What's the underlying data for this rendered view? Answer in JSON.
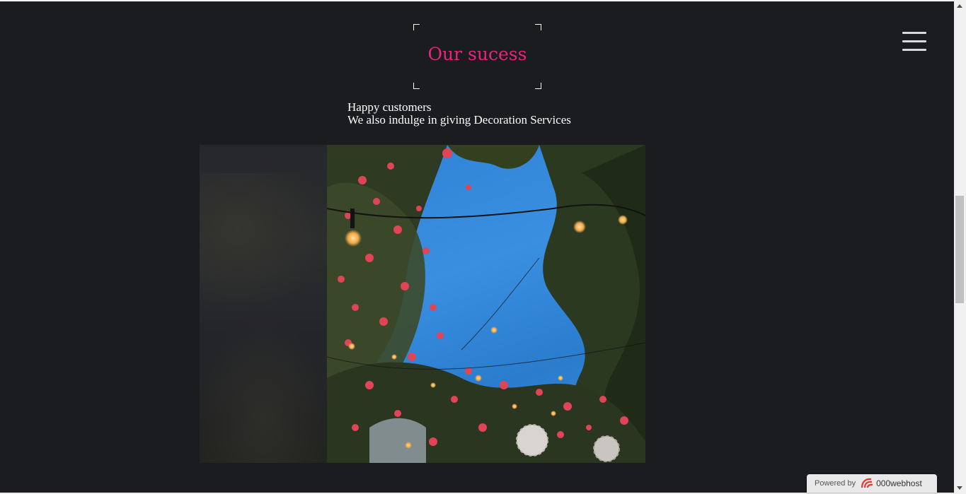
{
  "section": {
    "title": "Our sucess",
    "subtitle_line1": "Happy customers",
    "subtitle_line2": "We also indulge in giving Decoration Services"
  },
  "colors": {
    "background": "#1b1c20",
    "accent": "#e8247e",
    "text": "#ffffff"
  },
  "nav": {
    "menu_icon": "hamburger-icon"
  },
  "gallery": {
    "main_image": "flowering-tree-with-string-lights",
    "prev_image": "dimmed-previous-slide"
  },
  "badge": {
    "prefix": "Powered by",
    "brand": "000webhost",
    "logo_icon": "000webhost-logo-icon"
  }
}
